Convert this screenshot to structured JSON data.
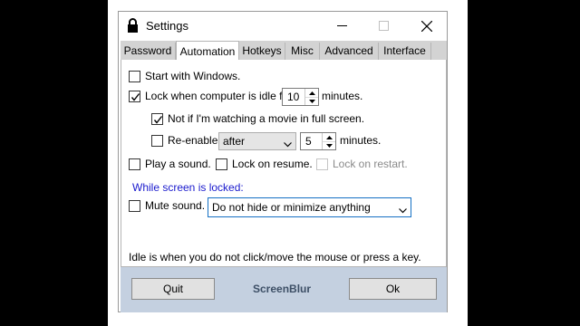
{
  "window": {
    "title": "Settings"
  },
  "tabs": [
    "Password",
    "Automation",
    "Hotkeys",
    "Misc",
    "Advanced",
    "Interface"
  ],
  "active_tab": "Automation",
  "automation": {
    "start_with_windows": {
      "label": "Start with Windows.",
      "checked": false
    },
    "lock_idle": {
      "label": "Lock when computer is idle for",
      "checked": true,
      "minutes": "10",
      "suffix": "minutes."
    },
    "not_if_movie": {
      "label": "Not if I'm watching a movie in full screen.",
      "checked": true
    },
    "reenable": {
      "label": "Re-enable",
      "checked": false,
      "mode": "after",
      "minutes": "5",
      "suffix": "minutes."
    },
    "play_sound": {
      "label": "Play a sound.",
      "checked": false
    },
    "lock_on_resume": {
      "label": "Lock on resume.",
      "checked": false
    },
    "lock_on_restart": {
      "label": "Lock on restart.",
      "checked": false,
      "enabled": false
    },
    "while_locked_label": "While screen is locked:",
    "mute_sound": {
      "label": "Mute sound.",
      "checked": false
    },
    "hide_option": "Do not hide or minimize anything",
    "note": "Idle is when you do not click/move the mouse or press a key."
  },
  "footer": {
    "quit_label": "Quit",
    "brand": "ScreenBlur",
    "ok_label": "Ok"
  }
}
